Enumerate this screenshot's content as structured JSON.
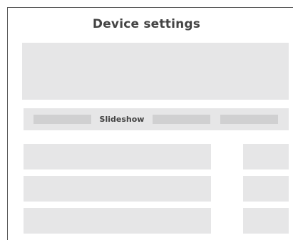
{
  "header": {
    "title": "Device settings"
  },
  "tabs": {
    "active_label": "Slideshow"
  },
  "colors": {
    "placeholder_fill": "#e6e6e7",
    "placeholder_dark": "#d0d0d1",
    "text": "#444444",
    "frame_border": "#5a5a5a"
  }
}
